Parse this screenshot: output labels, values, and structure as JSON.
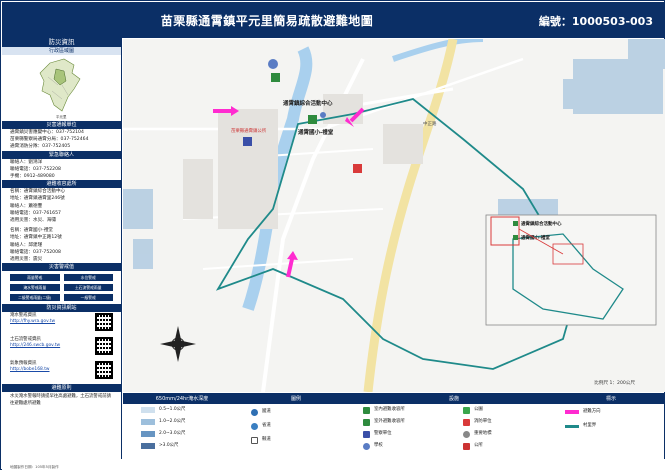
{
  "header": {
    "title": "苗栗縣通霄鎮平元里簡易疏散避難地圖",
    "code": "編號：1000503-003"
  },
  "sidebar": {
    "disaster_info": "防災資訊",
    "admin_area": "行政區域圖",
    "units_head": "災害通報單位",
    "units": [
      "通霄鎮災害應變中心：037-752104",
      "苗栗縣警察局通霄分局：037-752464",
      "通霄消防分隊：037-752405"
    ],
    "contact_head": "緊急聯絡人",
    "contact": [
      "聯絡人：劉鴻洋",
      "聯絡電話：037-752208",
      "手機：0912-489080"
    ],
    "shelter_head": "避難收容處所",
    "shelters": [
      "名稱：通霄鎮綜合活動中心",
      "地址：通霄鎮通霄里246號",
      "聯絡人：蕭德豐",
      "聯絡電話：037-761657",
      "適用災害：水災、海嘯",
      "名稱：通霄國小-禮堂",
      "地址：通霄鎮中正路12號",
      "聯絡人：邱建瑾",
      "聯絡電話：037-752008",
      "適用災害：震災"
    ],
    "warning_head": "災害警戒值",
    "warn_rain": "雨量警戒",
    "warn_level": "水位警戒",
    "warn_buttons": [
      "淹水警戒雨量",
      "土石流警戒",
      "二級警戒雨量：",
      "一級警戒雨量：",
      "三級警戒：",
      "二級警戒：",
      "一級警戒："
    ],
    "warn_row1": "淹水警戒雨量",
    "warn_row1b": "土石流警戒雨量",
    "warn_row2": "二級警戒雨量(二級)",
    "warn_row3a": "一級警戒",
    "warn_row3b": "二級警戒",
    "warn_row3c": "三級警戒",
    "web_head": "防災資訊網站",
    "webs": [
      {
        "name": "淹水警戒資訊",
        "url": "http://fhy.wra.gov.tw"
      },
      {
        "name": "土石流警戒資訊",
        "url": "http://246.swcb.gov.tw"
      },
      {
        "name": "氣象預報資訊",
        "url": "http://bobe168.tw"
      }
    ],
    "note_head": "避難原則",
    "note": "水災淹水警報時請提早往高處避難，土石流警戒前請往避難處所避難",
    "footer": "地圖製作日期：105年5月製作"
  },
  "map": {
    "labels": {
      "center": "通霄鎮綜合活動中心",
      "school": "通霄國小-禮堂",
      "gov": "苗栗縣通霄鎮公所",
      "road": "中正路",
      "rd": "海濱路"
    },
    "inset_center": "通霄鎮綜合活動中心",
    "inset_school": "通霄國小-禮堂",
    "scale": "比例尺 1：200公尺",
    "north": "N"
  },
  "legend": {
    "col1_head": "650mm/24hr淹水深度",
    "depths": [
      "0.5~1.0公尺",
      "1.0~2.0公尺",
      "2.0~3.0公尺",
      ">3.0公尺"
    ],
    "depth_colors": [
      "#cfe0ee",
      "#9dbfdc",
      "#6795c2",
      "#4a6f9e"
    ],
    "col2_head": "圖例",
    "roads": [
      "國道",
      "省道",
      "縣道"
    ],
    "col3_head": "設施",
    "facilities": [
      "室內避難收容所",
      "室外避難收容所",
      "警察單位",
      "學校"
    ],
    "facilities2": [
      "公園",
      "消防單位",
      "重要地標",
      "公所"
    ],
    "fac3": "消防單位",
    "col4_head": "標示",
    "marks": [
      "避難方向",
      "村里界"
    ]
  }
}
